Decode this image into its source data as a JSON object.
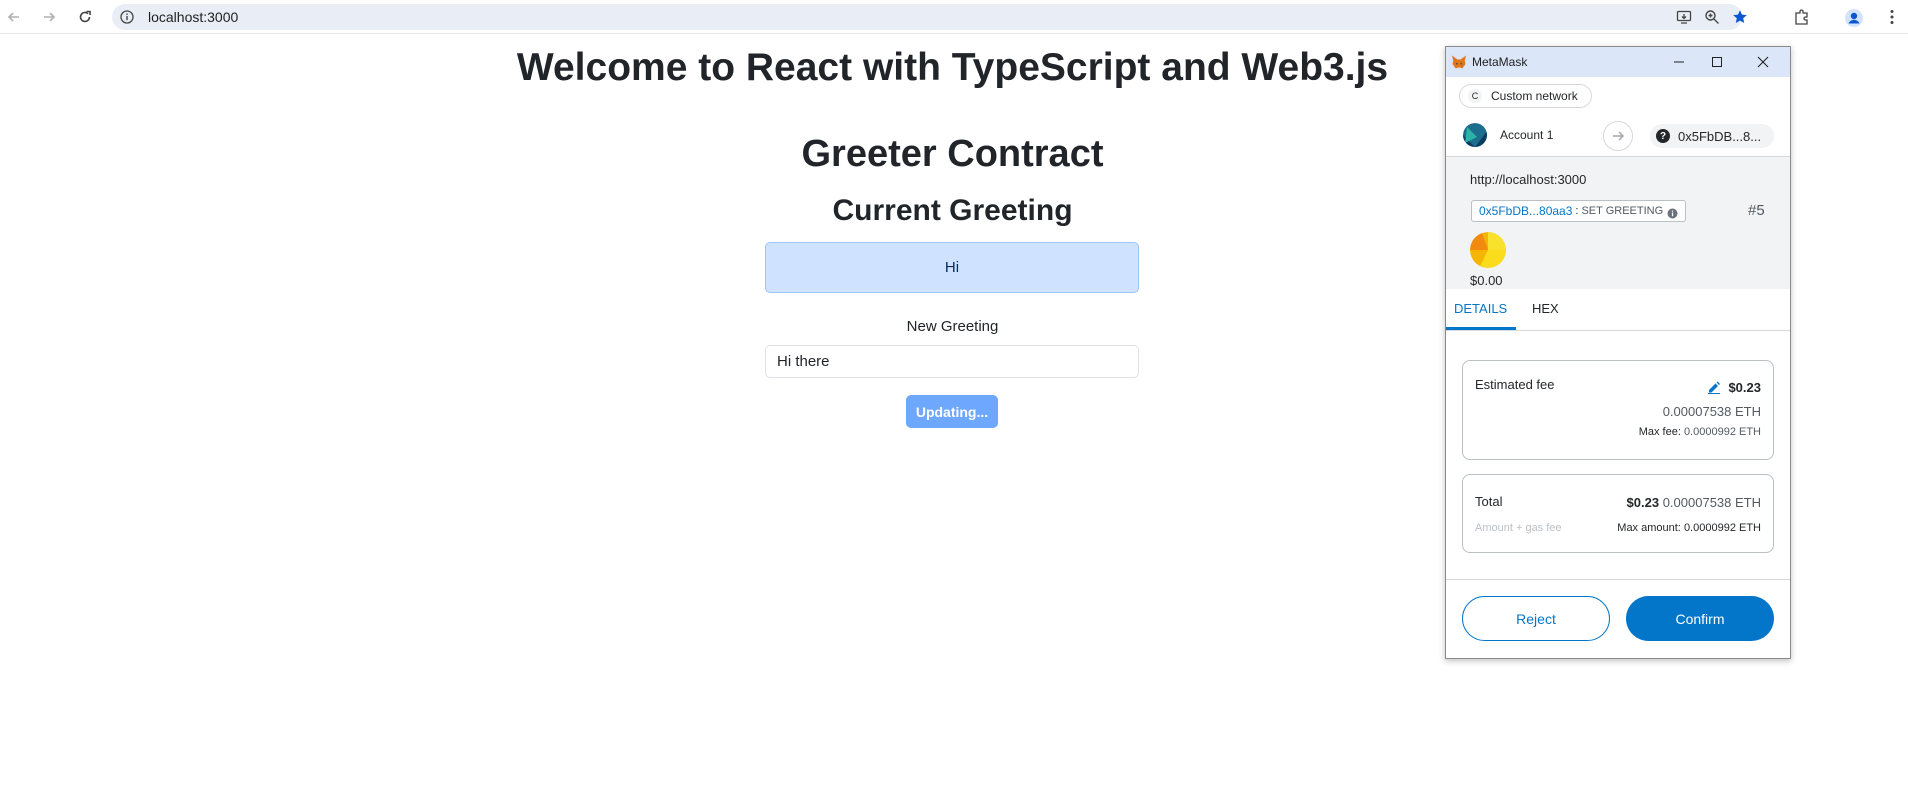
{
  "browser": {
    "url": "localhost:3000",
    "icons": {
      "back": "arrow-left-icon",
      "forward": "arrow-right-icon",
      "reload": "reload-icon",
      "site_info": "info-icon",
      "install": "install-app-icon",
      "zoom": "zoom-icon",
      "bookmark": "star-icon",
      "extensions": "puzzle-icon",
      "profile": "profile-icon",
      "menu": "kebab-menu-icon"
    }
  },
  "dapp": {
    "title": "Welcome to React with TypeScript and Web3.js",
    "contract_heading": "Greeter Contract",
    "current_greeting_heading": "Current Greeting",
    "current_greeting": "Hi",
    "new_greeting_label": "New Greeting",
    "new_greeting_value": "Hi there",
    "update_button": "Updating..."
  },
  "metamask": {
    "window_title": "MetaMask",
    "network_badge": "C",
    "network": "Custom network",
    "account_name": "Account 1",
    "recipient": "0x5FbDB...8...",
    "origin": "http://localhost:3000",
    "contract_address": "0x5FbDB...80aa3",
    "method_separator": ":",
    "method": "SET GREETING",
    "nonce": "#5",
    "value_usd": "$0.00",
    "tabs": [
      "DETAILS",
      "HEX"
    ],
    "active_tab": "DETAILS",
    "estimated_fee": {
      "label": "Estimated fee",
      "usd": "$0.23",
      "eth": "0.00007538 ETH",
      "max_label": "Max fee:",
      "max_value": "0.0000992 ETH"
    },
    "total": {
      "label": "Total",
      "usd": "$0.23",
      "eth": "0.00007538 ETH",
      "sub_label": "Amount + gas fee",
      "max_label": "Max amount:",
      "max_value": "0.0000992 ETH"
    },
    "reject": "Reject",
    "confirm": "Confirm",
    "colors": {
      "primary": "#0376c9",
      "title_bar": "#dbe6f8",
      "section_bg": "#f2f3f4"
    }
  }
}
